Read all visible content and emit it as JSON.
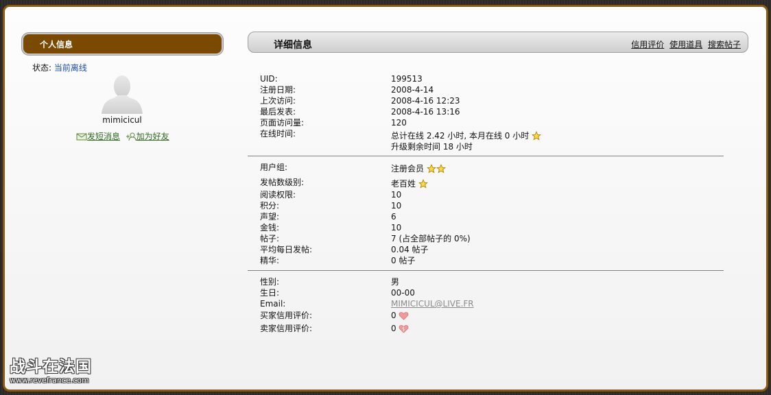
{
  "sidebar": {
    "header": "个人信息",
    "status_label": "状态:",
    "status_value": "当前离线",
    "username": "mimicicul",
    "send_message": "发短消息",
    "add_friend": "加为好友"
  },
  "main": {
    "title": "详细信息",
    "links": [
      "信用评价",
      "使用道具",
      "搜索帖子"
    ]
  },
  "section1": {
    "uid_label": "UID:",
    "uid": "199513",
    "reg_label": "注册日期:",
    "reg": "2008-4-14",
    "last_visit_label": "上次访问:",
    "last_visit": "2008-4-16 12:23",
    "last_post_label": "最后发表:",
    "last_post": "2008-4-16 13:16",
    "pageviews_label": "页面访问量:",
    "pageviews": "120",
    "online_label": "在线时间:",
    "online_line1": "总计在线 2.42 小时, 本月在线 0 小时",
    "online_line2": "升级剩余时间 18 小时"
  },
  "section2": {
    "group_label": "用户组:",
    "group": "注册会员",
    "postlevel_label": "发帖数级别:",
    "postlevel": "老百姓",
    "readperm_label": "阅读权限:",
    "readperm": "10",
    "credits_label": "积分:",
    "credits": "10",
    "reputation_label": "声望:",
    "reputation": "6",
    "money_label": "金钱:",
    "money": "10",
    "posts_label": "帖子:",
    "posts": "7 (占全部帖子的 0%)",
    "avgposts_label": "平均每日发帖:",
    "avgposts": "0.04 帖子",
    "digest_label": "精华:",
    "digest": "0 帖子"
  },
  "section3": {
    "gender_label": "性别:",
    "gender": "男",
    "birthday_label": "生日:",
    "birthday": "00-00",
    "email_label": "Email:",
    "email": "MIMICICUL@LIVE.FR",
    "buyer_label": "买家信用评价:",
    "buyer": "0",
    "seller_label": "卖家信用评价:",
    "seller": "0"
  },
  "watermark": {
    "name": "战斗在法国",
    "url": "www.revefrance.com"
  },
  "icons": [
    "star-icon",
    "heart-icon",
    "broken-heart-icon",
    "message-icon",
    "add-friend-icon",
    "avatar-silhouette-icon"
  ],
  "colors": {
    "accent": "#7a4a02",
    "link": "#1c4fa5",
    "action_link": "#2e6b1e",
    "star": "#f5c400"
  }
}
